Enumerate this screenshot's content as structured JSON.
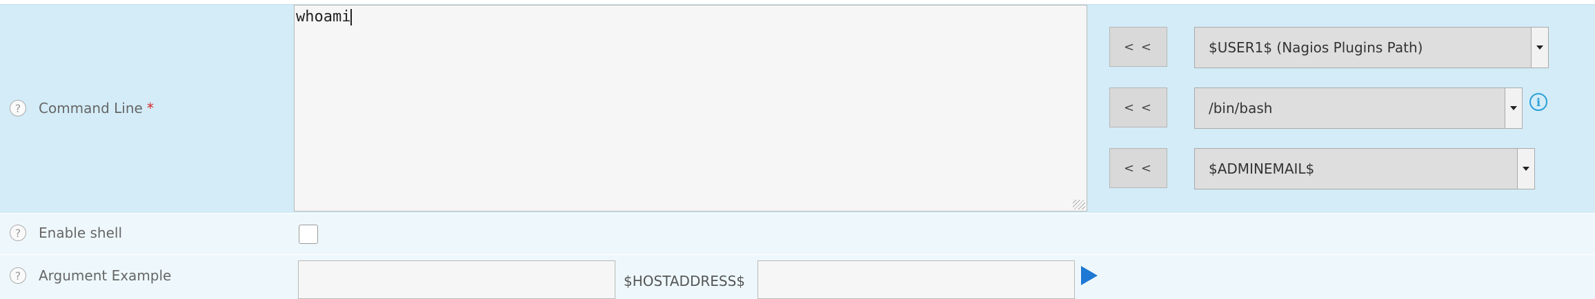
{
  "command_line": {
    "label": "Command Line",
    "required_marker": "*",
    "help_icon": "?",
    "textarea_value": "whoami",
    "insert_buttons": [
      "< <",
      "< <",
      "< <"
    ],
    "selects": [
      {
        "value": "$USER1$ (Nagios Plugins Path)"
      },
      {
        "value": "/bin/bash"
      },
      {
        "value": "$ADMINEMAIL$"
      }
    ],
    "info_icon": "i"
  },
  "enable_shell": {
    "label": "Enable shell",
    "help_icon": "?",
    "checked": false
  },
  "argument_example": {
    "label": "Argument Example",
    "help_icon": "?",
    "macro_text": "$HOSTADDRESS$",
    "input1_value": "",
    "input2_value": ""
  },
  "colors": {
    "row_highlight": "#d3ecf7",
    "row_light": "#eef8fc",
    "required": "#d9262a",
    "accent_blue": "#1e78d4",
    "info_blue": "#2a9fd6"
  }
}
